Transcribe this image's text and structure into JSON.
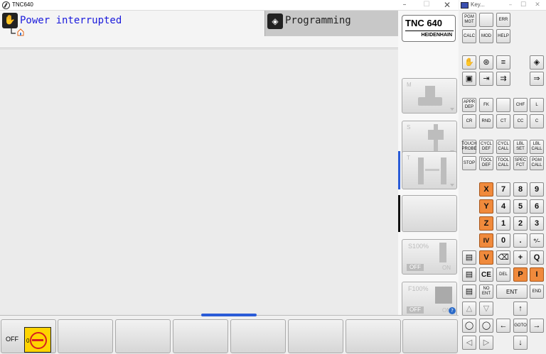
{
  "tnc_window": {
    "title": "TNC640",
    "mode_text": "Power interrupted",
    "programming_tab": "Programming",
    "logo_model": "TNC 640",
    "logo_brand": "HEIDENHAIN",
    "side_softkeys": {
      "m_label": "M",
      "s_label": "S",
      "t_label": "T",
      "s_override": "S100%",
      "f_override": "F100%",
      "off_label": "OFF",
      "on_label": "ON"
    },
    "bottom_softkeys": {
      "off_label": "OFF",
      "off_icon_digit": "0"
    }
  },
  "keyboard_window": {
    "title": "Key...",
    "keys": {
      "pgm_mgt": "PGM MGT",
      "err": "ERR",
      "calc": "CALC",
      "mod": "MOD",
      "help": "HELP",
      "appr_dep": "APPR DEP",
      "fk": "FK",
      "chf": "CHF",
      "l": "L",
      "cr": "CR",
      "rnd": "RND",
      "ct": "CT",
      "cc": "CC",
      "c": "C",
      "touch_probe": "TOUCH PROBE",
      "cycl_def": "CYCL DEF",
      "cycl_call": "CYCL CALL",
      "lbl_set": "LBL SET",
      "lbl_call": "LBL CALL",
      "stop": "STOP",
      "tool_def": "TOOL DEF",
      "tool_call": "TOOL CALL",
      "spec_fct": "SPEC FCT",
      "pgm_call": "PGM CALL",
      "x": "X",
      "y": "Y",
      "z": "Z",
      "iv": "IV",
      "v": "V",
      "n7": "7",
      "n8": "8",
      "n9": "9",
      "n4": "4",
      "n5": "5",
      "n6": "6",
      "n1": "1",
      "n2": "2",
      "n3": "3",
      "n0": "0",
      "dot": ".",
      "pm": "⁺∕₋",
      "plus": "+",
      "q": "Q",
      "ce": "CE",
      "del": "DEL",
      "p": "P",
      "i": "I",
      "no_ent": "NO ENT",
      "ent": "ENT",
      "end": "END",
      "goto": "GOTO"
    }
  }
}
